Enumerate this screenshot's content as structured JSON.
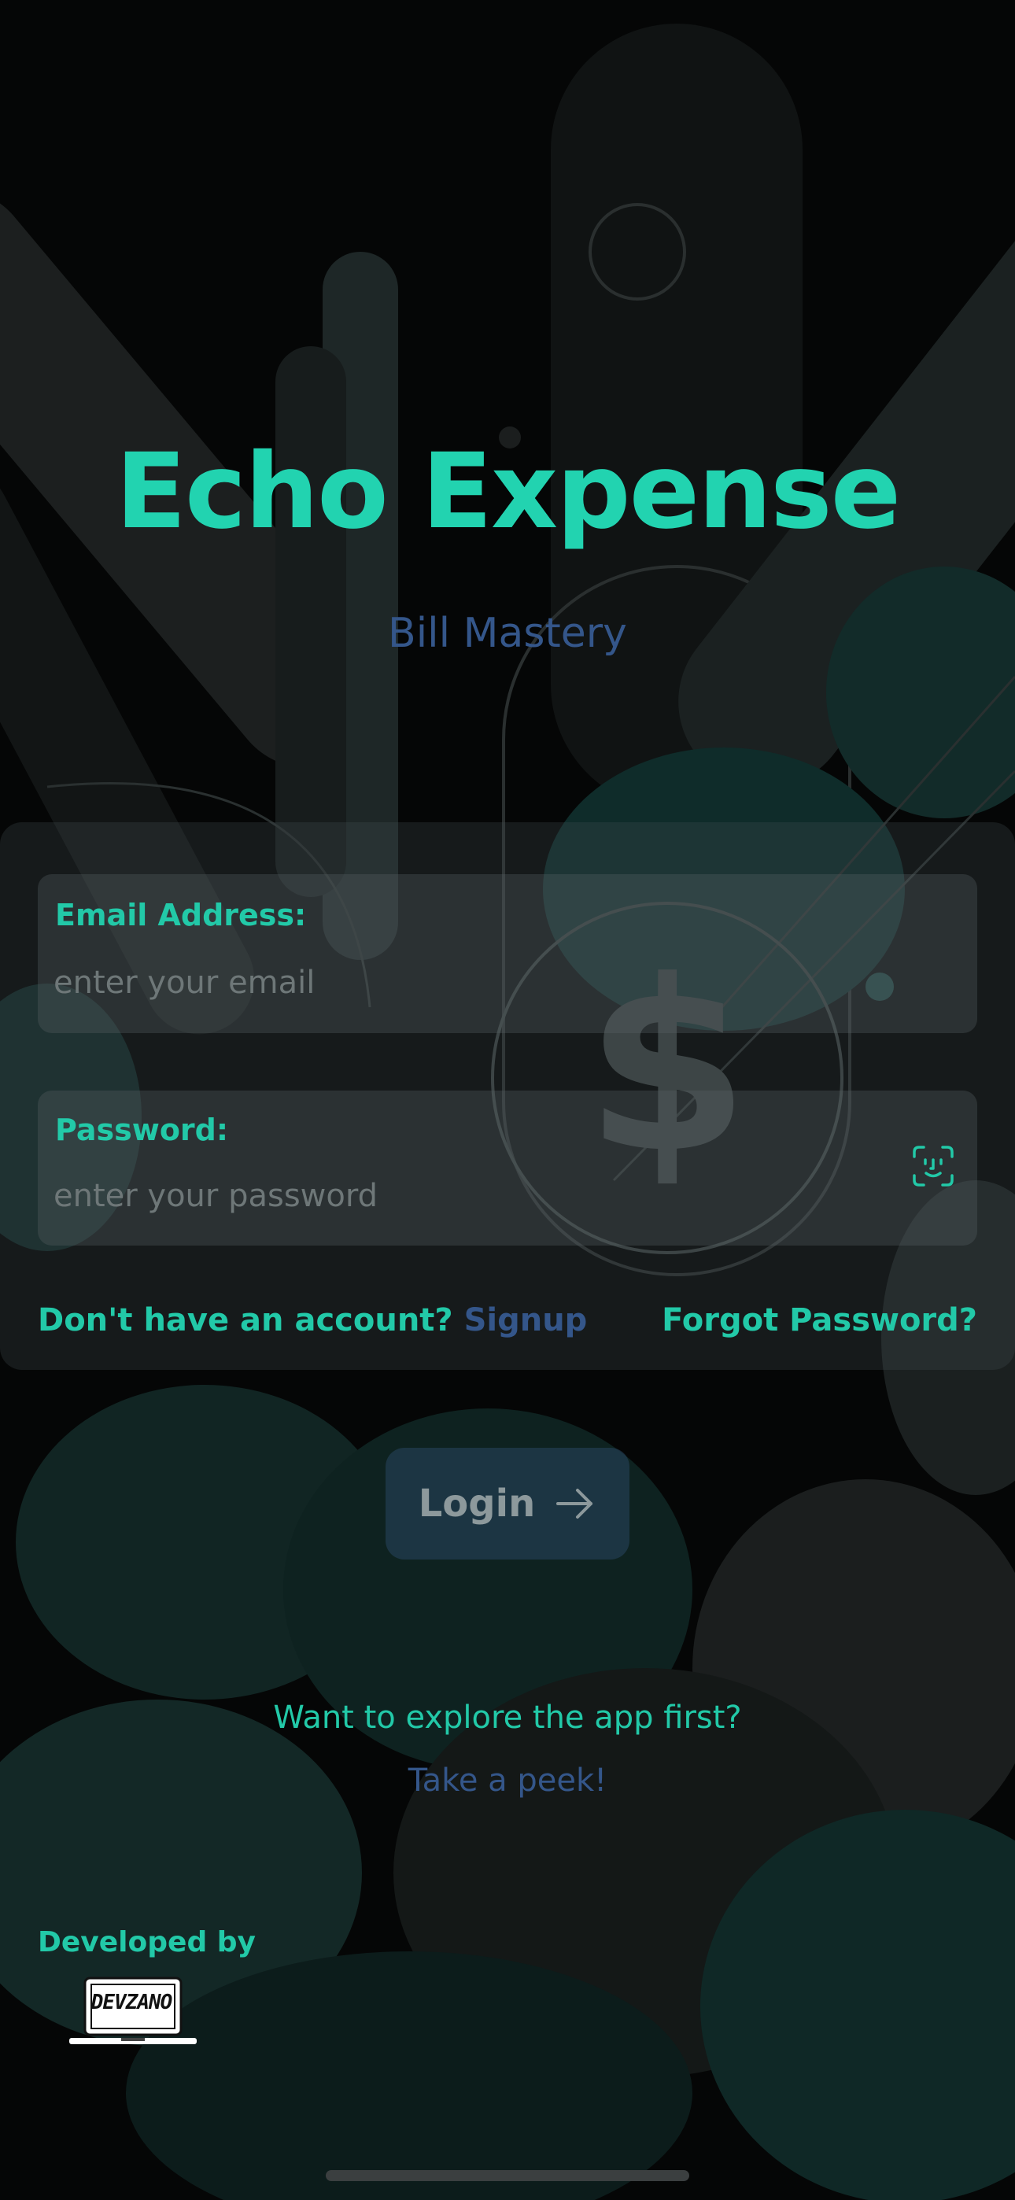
{
  "app": {
    "title": "Echo Expense",
    "subtitle": "Bill Mastery"
  },
  "form": {
    "email_label": "Email Address:",
    "email_placeholder": "enter your email",
    "password_label": "Password:",
    "password_placeholder": "enter your password",
    "no_account_text": "Don't have an account?",
    "signup_link": "Signup",
    "forgot_password": "Forgot Password?"
  },
  "login": {
    "label": "Login"
  },
  "explore": {
    "question": "Want to explore the app first?",
    "peek_link": "Take a peek!"
  },
  "footer": {
    "developed_by": "Developed by",
    "developer_logo": "DEVZANO"
  },
  "icons": {
    "faceid": "faceid-icon",
    "arrow": "arrow-right-icon",
    "dollar": "dollar-sign-icon"
  },
  "colors": {
    "accent": "#22d3b0",
    "link": "#34568a",
    "background": "#050606"
  }
}
